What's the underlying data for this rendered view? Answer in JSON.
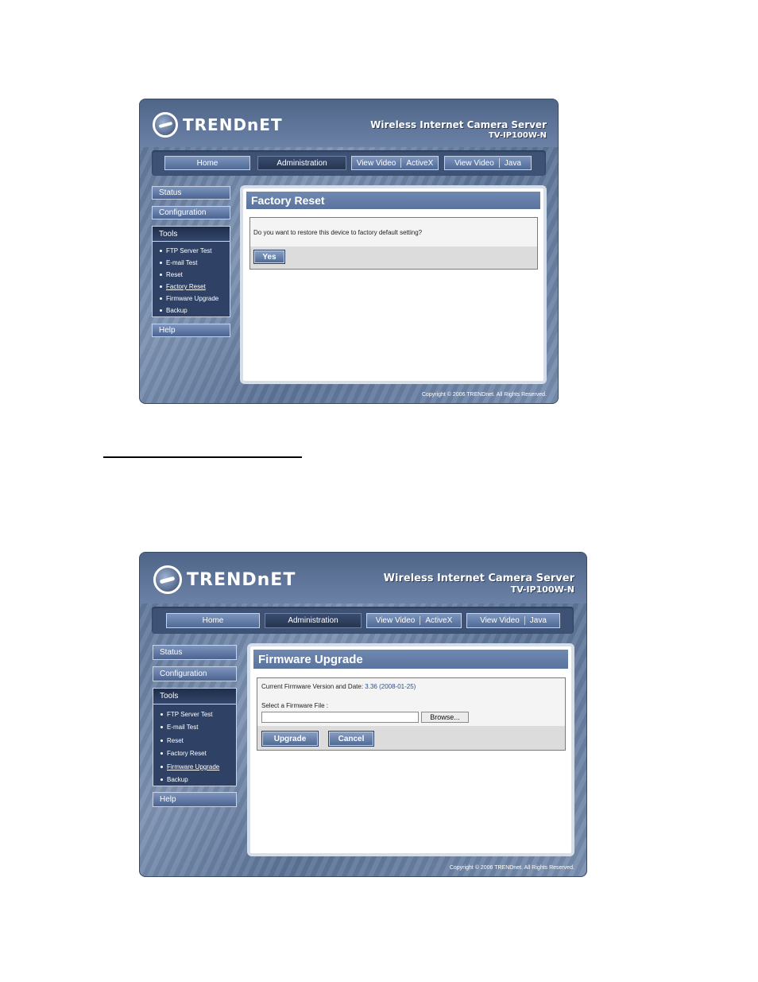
{
  "brand": "TRENDnET",
  "product_title": "Wireless Internet Camera Server",
  "model": "TV-IP100W-N",
  "nav": {
    "home": "Home",
    "administration": "Administration",
    "view_video_1": "View Video",
    "activex": "ActiveX",
    "view_video_2": "View Video",
    "java": "Java"
  },
  "sidebar": {
    "status": "Status",
    "configuration": "Configuration",
    "tools": "Tools",
    "tool_items": [
      "FTP Server Test",
      "E-mail Test",
      "Reset",
      "Factory Reset",
      "Firmware Upgrade",
      "Backup"
    ],
    "help": "Help"
  },
  "factory_reset": {
    "title": "Factory Reset",
    "question": "Do you want to restore this device to factory default setting?",
    "yes_button": "Yes",
    "active_tool": "Factory Reset"
  },
  "firmware_upgrade": {
    "title": "Firmware Upgrade",
    "current_label": "Current Firmware Version and Date:",
    "current_value": "3.36 (2008-01-25)",
    "select_label": "Select a Firmware File :",
    "file_value": "",
    "browse_button": "Browse...",
    "upgrade_button": "Upgrade",
    "cancel_button": "Cancel",
    "active_tool": "Firmware Upgrade"
  },
  "copyright": "Copyright © 2006 TRENDnet. All Rights Reserved."
}
